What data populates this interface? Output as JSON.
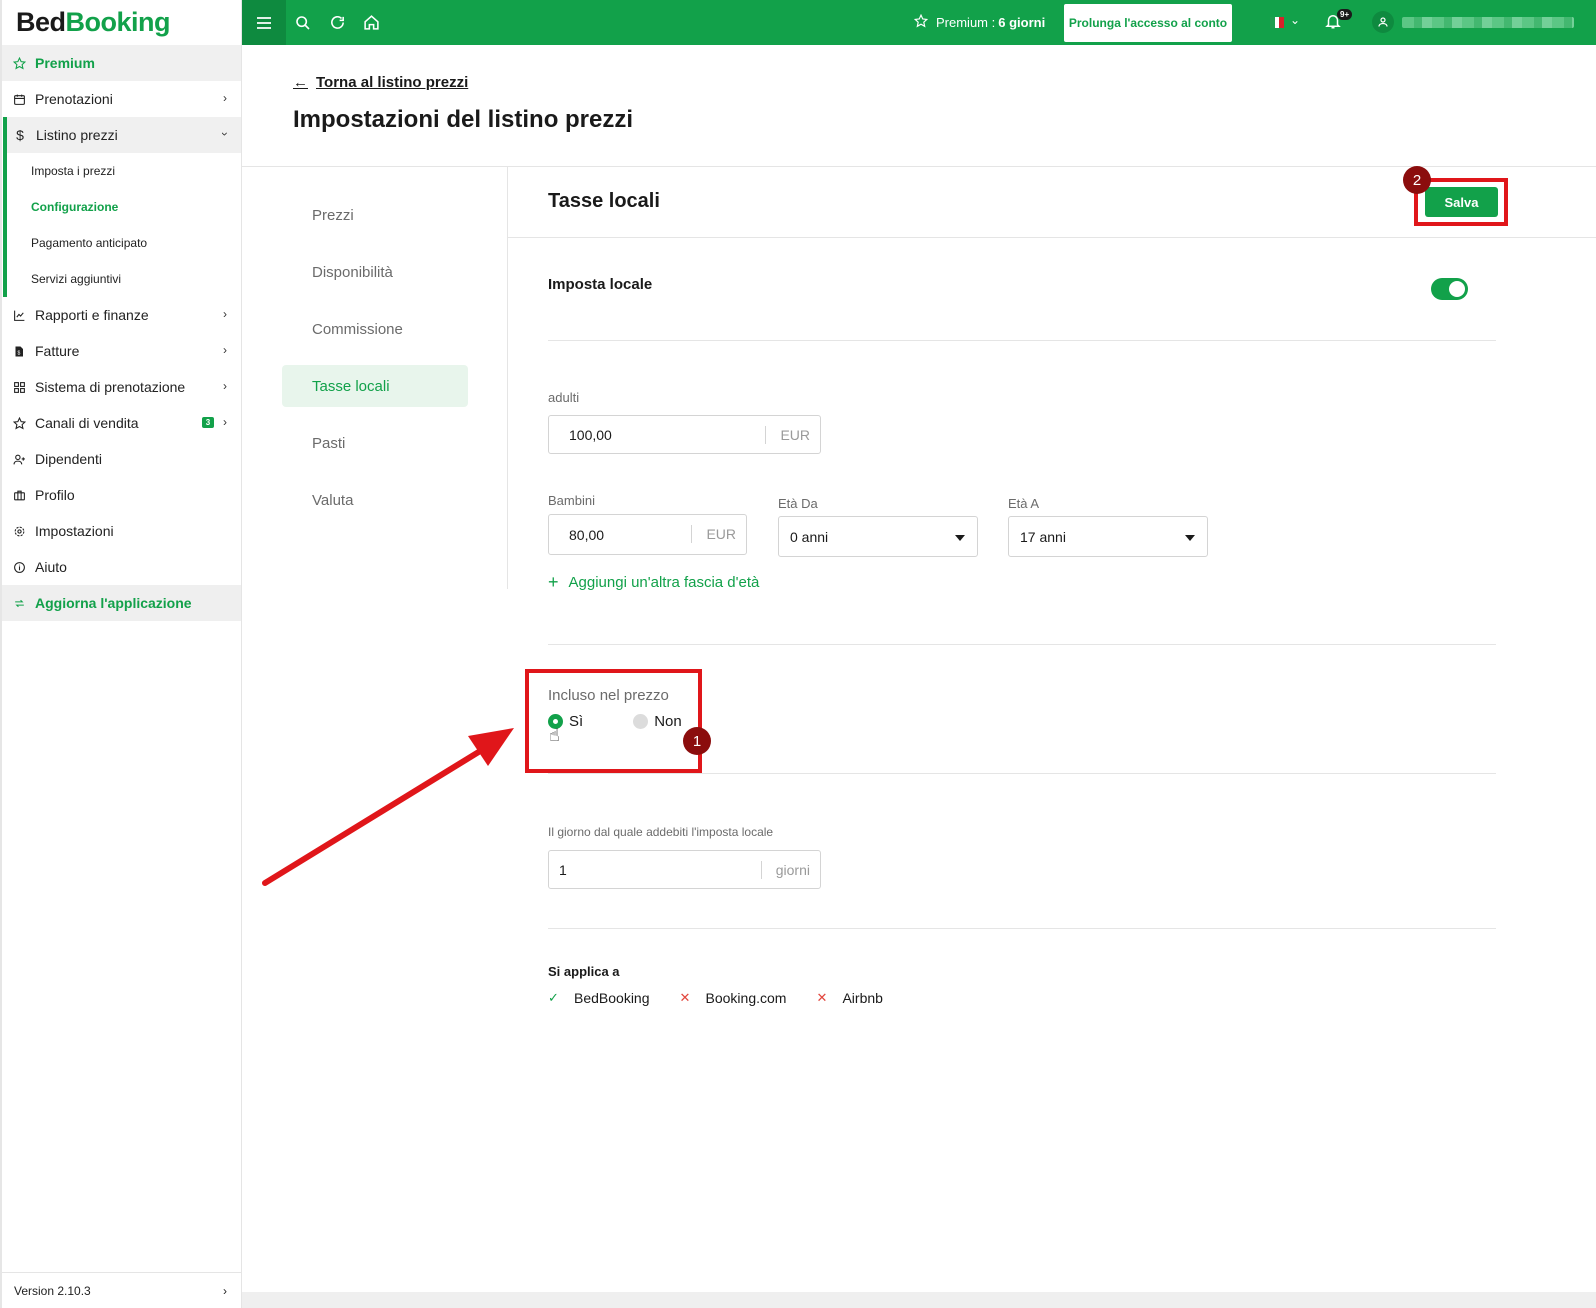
{
  "brand": {
    "part1": "Bed",
    "part2": "Booking"
  },
  "sidebar": {
    "items": [
      {
        "label": "Premium"
      },
      {
        "label": "Prenotazioni"
      },
      {
        "label": "Listino prezzi"
      },
      {
        "label": "Rapporti e finanze"
      },
      {
        "label": "Fatture"
      },
      {
        "label": "Sistema di prenotazione"
      },
      {
        "label": "Canali di vendita",
        "badge": "3"
      },
      {
        "label": "Dipendenti"
      },
      {
        "label": "Profilo"
      },
      {
        "label": "Impostazioni"
      },
      {
        "label": "Aiuto"
      },
      {
        "label": "Aggiorna l'applicazione"
      }
    ],
    "subitems": [
      {
        "label": "Imposta i prezzi"
      },
      {
        "label": "Configurazione"
      },
      {
        "label": "Pagamento anticipato"
      },
      {
        "label": "Servizi aggiuntivi"
      }
    ],
    "version": "Version 2.10.3"
  },
  "topbar": {
    "premium_label": "Premium :",
    "premium_days": "6 giorni",
    "extend_button": "Prolunga l'accesso al conto",
    "notif_badge": "9+"
  },
  "page": {
    "back_link": "Torna al listino prezzi",
    "title": "Impostazioni del listino prezzi"
  },
  "settings_nav": [
    {
      "label": "Prezzi"
    },
    {
      "label": "Disponibilità"
    },
    {
      "label": "Commissione"
    },
    {
      "label": "Tasse locali"
    },
    {
      "label": "Pasti"
    },
    {
      "label": "Valuta"
    }
  ],
  "panel": {
    "title": "Tasse locali",
    "save_button": "Salva",
    "local_tax_label": "Imposta locale",
    "local_tax_enabled": true,
    "adults_label": "adulti",
    "adults_value": "100,00",
    "adults_unit": "EUR",
    "children_label": "Bambini",
    "children_value": "80,00",
    "children_unit": "EUR",
    "age_from_label": "Età Da",
    "age_from_value": "0 anni",
    "age_to_label": "Età A",
    "age_to_value": "17 anni",
    "add_age_range": "Aggiungi un'altra fascia d'età",
    "included_label": "Incluso nel prezzo",
    "included_yes": "Sì",
    "included_no": "Non",
    "included_selected": "yes",
    "start_day_label": "Il giorno dal quale addebiti l'imposta locale",
    "start_day_value": "1",
    "start_day_unit": "giorni",
    "applies_title": "Si applica a",
    "channels": [
      {
        "label": "BedBooking",
        "enabled": true
      },
      {
        "label": "Booking.com",
        "enabled": false
      },
      {
        "label": "Airbnb",
        "enabled": false
      }
    ]
  },
  "annotations": {
    "step1": "1",
    "step2": "2"
  },
  "colors": {
    "accent": "#12a14a",
    "annotation": "#e0161a",
    "annotation_badge": "#8b0d0d"
  }
}
